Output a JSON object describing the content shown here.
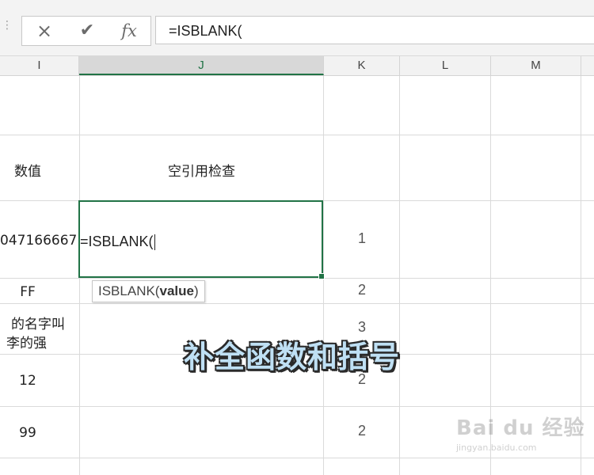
{
  "formula_bar": {
    "cancel_icon": "×",
    "enter_icon": "✔",
    "fx_label": "fx",
    "formula": "=ISBLANK("
  },
  "columns": [
    "I",
    "J",
    "K",
    "L",
    "M"
  ],
  "rows": {
    "r1": {
      "i": "",
      "j": "",
      "k": ""
    },
    "r2": {
      "i": "数值",
      "j": "空引用检查",
      "k": ""
    },
    "r3": {
      "i": "047166667",
      "j": "=ISBLANK(",
      "k": "1"
    },
    "r4": {
      "i": "FF",
      "j": "",
      "k": "2"
    },
    "r5": {
      "i_line1": "的名字叫",
      "i_line2": "李的强",
      "j": "",
      "k": "3"
    },
    "r6": {
      "i": "12",
      "j": "",
      "k": "2"
    },
    "r7": {
      "i": "99",
      "j": "",
      "k": "2"
    }
  },
  "tooltip": {
    "func": "ISBLANK(",
    "arg": "value",
    "close": ")"
  },
  "overlay_caption": "补全函数和括号",
  "watermark": {
    "brand": "Bai du 经验",
    "url": "jingyan.baidu.com"
  },
  "colors": {
    "accent": "#217346"
  }
}
